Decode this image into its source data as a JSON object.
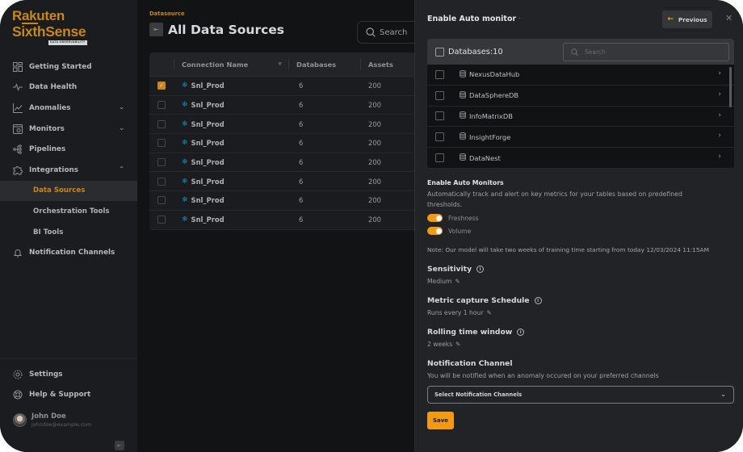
{
  "brand": {
    "line1": "Rakuten",
    "line2": "SixthSense",
    "tagline": "DATA OBSERVABILITY"
  },
  "sidebar": {
    "items": [
      {
        "label": "Getting Started",
        "icon": "grid-icon"
      },
      {
        "label": "Data Health",
        "icon": "pulse-icon"
      },
      {
        "label": "Anomalies",
        "icon": "chart-icon",
        "chevron": "down"
      },
      {
        "label": "Monitors",
        "icon": "monitor-icon",
        "chevron": "down"
      },
      {
        "label": "Pipelines",
        "icon": "pipeline-icon"
      },
      {
        "label": "Integrations",
        "icon": "puzzle-icon",
        "chevron": "up"
      }
    ],
    "sub_items": [
      {
        "label": "Data Sources",
        "active": true
      },
      {
        "label": "Orchestration Tools",
        "active": false
      },
      {
        "label": "BI Tools",
        "active": false
      }
    ],
    "notification_item": {
      "label": "Notification Channels",
      "icon": "bell-icon"
    },
    "bottom": [
      {
        "label": "Settings",
        "icon": "gear-icon"
      },
      {
        "label": "Help & Support",
        "icon": "lifebuoy-icon"
      }
    ],
    "user": {
      "name": "John Doe",
      "email": "johndoe@example.com"
    }
  },
  "main": {
    "breadcrumb": "Datasource",
    "title": "All Data Sources",
    "search_placeholder": "Search",
    "table": {
      "columns": [
        "Connection Name",
        "Databases",
        "Assets"
      ],
      "rows": [
        {
          "name": "Snl_Prod",
          "databases": "6",
          "assets": "200",
          "checked": true
        },
        {
          "name": "Snl_Prod",
          "databases": "6",
          "assets": "200",
          "checked": false
        },
        {
          "name": "Snl_Prod",
          "databases": "6",
          "assets": "200",
          "checked": false
        },
        {
          "name": "Snl_Prod",
          "databases": "6",
          "assets": "200",
          "checked": false
        },
        {
          "name": "Snl_Prod",
          "databases": "6",
          "assets": "200",
          "checked": false
        },
        {
          "name": "Snl_Prod",
          "databases": "6",
          "assets": "200",
          "checked": false
        },
        {
          "name": "Snl_Prod",
          "databases": "6",
          "assets": "200",
          "checked": false
        },
        {
          "name": "Snl_Prod",
          "databases": "6",
          "assets": "200",
          "checked": false
        }
      ]
    }
  },
  "drawer": {
    "title": "Enable Auto monitor",
    "title_suffix": "·",
    "previous_label": "Previous",
    "close_label": "✕",
    "databases_label": "Databases:10",
    "search_placeholder": "Search",
    "databases": [
      "NexusDataHub",
      "DataSphereDB",
      "InfoMatrixDB",
      "InsightForge",
      "DataNest"
    ],
    "auto_monitors": {
      "title": "Enable Auto Monitors",
      "description": "Automatically track and alert on key metrics for your tables based on predefined thresholds.",
      "toggles": [
        {
          "label": "Freshness",
          "on": true
        },
        {
          "label": "Volume",
          "on": true
        }
      ],
      "note": "Note: Our model will take two weeks of training time starting from today 12/03/2024 11:15AM"
    },
    "fields": [
      {
        "title": "Sensitivity",
        "value": "Medium"
      },
      {
        "title": "Metric capture Schedule",
        "value": "Runs every 1 hour"
      },
      {
        "title": "Rolling time window",
        "value": "2 weeks"
      }
    ],
    "notification": {
      "title": "Notification Channel",
      "description": "You will be notified when an anomaly occured on your preferred channels",
      "select_placeholder": "Select Notification Channels"
    },
    "save_label": "Save"
  },
  "colors": {
    "accent": "#c8861c",
    "toggle_on": "#f29a13",
    "snowflake": "#1d8bbf"
  }
}
